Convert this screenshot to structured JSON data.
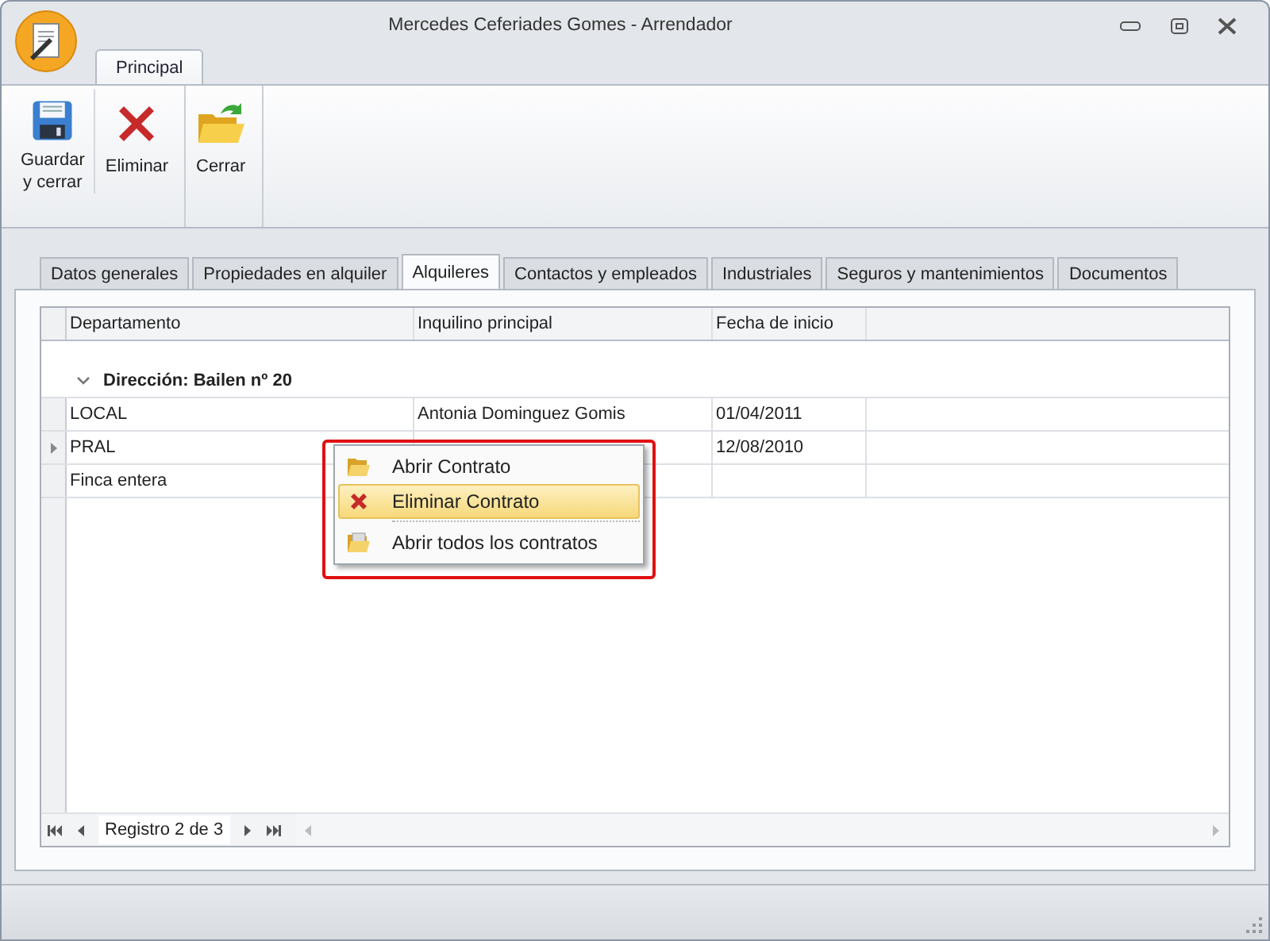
{
  "window": {
    "title": "Mercedes Ceferiades Gomes - Arrendador"
  },
  "ribbon": {
    "tabs": [
      {
        "label": "Principal",
        "selected": true
      }
    ],
    "buttons": [
      {
        "kind": "save",
        "label": "Guardar\ny cerrar"
      },
      {
        "kind": "delete",
        "label": "Eliminar"
      },
      {
        "kind": "close",
        "label": "Cerrar"
      }
    ]
  },
  "tabs": [
    {
      "label": "Datos generales",
      "selected": false
    },
    {
      "label": "Propiedades en alquiler",
      "selected": false
    },
    {
      "label": "Alquileres",
      "selected": true
    },
    {
      "label": "Contactos y empleados",
      "selected": false
    },
    {
      "label": "Industriales",
      "selected": false
    },
    {
      "label": "Seguros y mantenimientos",
      "selected": false
    },
    {
      "label": "Documentos",
      "selected": false
    }
  ],
  "table": {
    "columns": [
      "Departamento",
      "Inquilino principal",
      "Fecha de inicio"
    ],
    "group": {
      "label": "Dirección: Bailen nº 20",
      "expanded": true
    },
    "rows": [
      {
        "cells": [
          "LOCAL",
          "Antonia Dominguez Gomis",
          "01/04/2011"
        ],
        "selected": false
      },
      {
        "cells": [
          "PRAL",
          "",
          "12/08/2010"
        ],
        "selected": true
      },
      {
        "cells": [
          "Finca entera",
          "",
          ""
        ],
        "selected": false
      }
    ]
  },
  "context_menu": {
    "items": [
      {
        "kind": "open",
        "label": "Abrir Contrato",
        "selected": false
      },
      {
        "kind": "delete",
        "label": "Eliminar Contrato",
        "selected": true
      },
      {
        "kind": "open_all",
        "label": "Abrir todos los contratos",
        "selected": false
      }
    ]
  },
  "navigator": {
    "record": "Registro 2 de 3"
  }
}
